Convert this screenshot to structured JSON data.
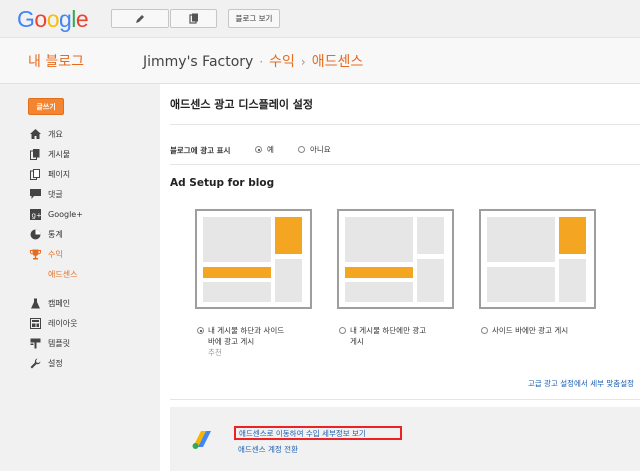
{
  "topbar": {
    "logo_letters": [
      "G",
      "o",
      "o",
      "g",
      "l",
      "e"
    ],
    "logo_colors": [
      "#4285F4",
      "#EA4335",
      "#FBBC05",
      "#4285F4",
      "#34A853",
      "#EA4335"
    ],
    "view_blog_label": "블로그 보기"
  },
  "header": {
    "my_blog": "내 블로그",
    "blog_name": "Jimmy's Factory",
    "dot": "·",
    "section": "수익",
    "arrow": "›",
    "page": "애드센스"
  },
  "sidebar": {
    "write_label": "글쓰기",
    "items": [
      {
        "label": "개요",
        "icon": "home-icon"
      },
      {
        "label": "게시물",
        "icon": "posts-icon"
      },
      {
        "label": "페이지",
        "icon": "pages-icon"
      },
      {
        "label": "댓글",
        "icon": "comment-icon"
      },
      {
        "label": "Google+",
        "icon": "google-plus-icon"
      },
      {
        "label": "통계",
        "icon": "stats-icon"
      },
      {
        "label": "수익",
        "icon": "trophy-icon"
      },
      {
        "label": "애드센스",
        "icon": ""
      },
      {
        "label": "캠페인",
        "icon": "campaign-icon"
      },
      {
        "label": "레이아웃",
        "icon": "layout-icon"
      },
      {
        "label": "템플릿",
        "icon": "template-icon"
      },
      {
        "label": "설정",
        "icon": "wrench-icon"
      }
    ]
  },
  "main": {
    "title": "애드센스 광고 디스플레이 설정",
    "show_ads_label": "블로그에 광고 표시",
    "show_ads_yes": "예",
    "show_ads_no": "아니요",
    "setup_title": "Ad Setup for blog",
    "choices": [
      {
        "line1": "내 게시물 하단과 사이드",
        "line2": "바에 광고 게시",
        "sub": "추천",
        "selected": true
      },
      {
        "line1": "내 게시물 하단에만 광고",
        "line2": "게시",
        "sub": "",
        "selected": false
      },
      {
        "line1": "사이드 바에만 광고 게시",
        "line2": "",
        "sub": "",
        "selected": false
      }
    ],
    "advanced_link": "고급 광고 설정에서 세부 맞춤설정",
    "adsense_details_link": "애드센스로 이동하여 수입 세부정보 보기",
    "switch_account_link": "애드센스 계정 전환"
  },
  "colors": {
    "accent": "#e56b1f",
    "ad_block": "#f4a623",
    "link": "#1a5fb4",
    "highlight_border": "#ee2222"
  }
}
